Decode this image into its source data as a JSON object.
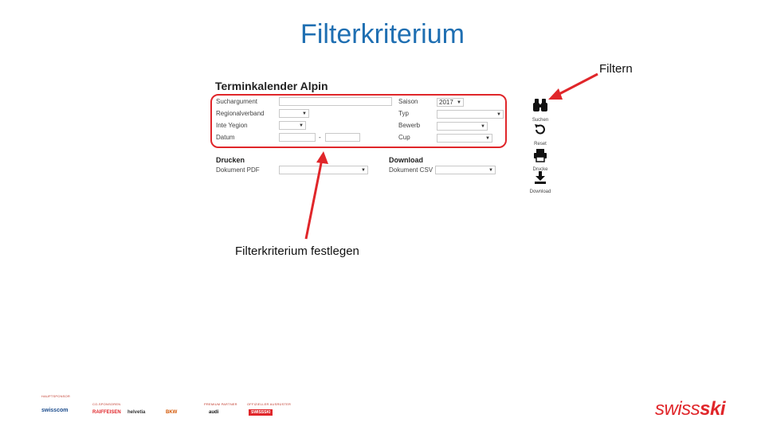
{
  "slide": {
    "title": "Filterkriterium",
    "callout_filter": "Filtern",
    "callout_criteria": "Filterkriterium festlegen"
  },
  "panel": {
    "title": "Terminkalender Alpin",
    "fields_left": [
      {
        "label": "Suchargument"
      },
      {
        "label": "Regionalverband"
      },
      {
        "label": "Inte Yegion"
      },
      {
        "label": "Datum"
      }
    ],
    "date_separator": "-",
    "fields_right": [
      {
        "label": "Saison",
        "value": "2017"
      },
      {
        "label": "Typ"
      },
      {
        "label": "Bewerb"
      },
      {
        "label": "Cup"
      }
    ],
    "print": {
      "title": "Drucken",
      "label": "Dokument PDF"
    },
    "download": {
      "title": "Download",
      "label": "Dokument CSV"
    }
  },
  "toolbar": {
    "search": {
      "label": "Suchen",
      "icon": "binoculars-icon"
    },
    "reset": {
      "label": "Reset",
      "icon": "undo-icon"
    },
    "print": {
      "label": "Drucke",
      "icon": "printer-icon"
    },
    "download": {
      "label": "Download",
      "icon": "download-icon"
    }
  },
  "sponsors": {
    "cat_main": "HAUPTSPONSOR",
    "cat_co": "CO-SPONSOREN",
    "cat_premium": "PREMIUM PARTNER",
    "cat_supplier": "OFFIZIELLER AUSRÜSTER",
    "logos": [
      "swisscom",
      "RAIFFEISEN",
      "helvetia",
      "BKW",
      "audi",
      "SWISSSKI"
    ]
  },
  "brand": {
    "part1": "swiss",
    "part2": "ski"
  },
  "colors": {
    "accent": "#e0262a",
    "title": "#1f6fb2"
  }
}
